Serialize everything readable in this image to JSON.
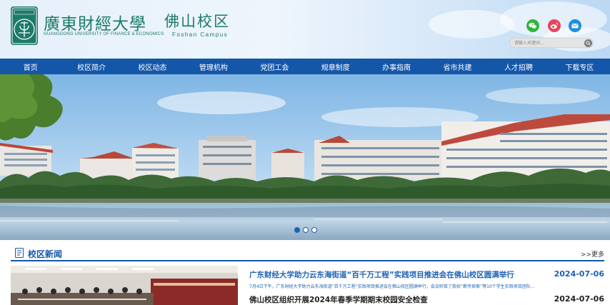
{
  "brand": {
    "title_cn": "廣東財經大學",
    "subtitle_en": "GUANGDONG UNIVERSITY OF FINANCE & ECONOMICS",
    "campus_cn": "佛山校区",
    "campus_en": "Foshan Campus",
    "seal_text": "广东财经大学"
  },
  "header": {
    "social": [
      {
        "name": "wechat",
        "color": "#2fb63c"
      },
      {
        "name": "weibo",
        "color": "#e9455b"
      },
      {
        "name": "email",
        "color": "#1f8fdd"
      }
    ],
    "search_placeholder": "请输入关键词..."
  },
  "nav": {
    "items": [
      "首页",
      "校区简介",
      "校区动态",
      "管理机构",
      "党团工会",
      "规章制度",
      "办事指南",
      "省市共建",
      "人才招聘",
      "下载专区"
    ]
  },
  "banner": {
    "slide_count": 3,
    "active_slide": 1
  },
  "news": {
    "section_title": "校区新闻",
    "more_label": ">>更多",
    "items": [
      {
        "title": "广东财经大学助力云东海街道“百千万工程”实践项目推进会在佛山校区圆满举行",
        "date": "2024-07-06",
        "summary": "7月4日下午，广东财经大学助力云东海街道“百千万工程”实践项目推进会在佛山校区圆满举行，会议听取了我校“薪传探索”等10个学生实践项目团队…",
        "color": "#1d62b4"
      },
      {
        "title": "佛山校区组织开展2024年春季学期期末校园安全检查",
        "date": "2024-07-06",
        "color": "#222222"
      }
    ]
  },
  "colors": {
    "brand_green": "#1d7a6a",
    "nav_blue": "#1457a9",
    "accent_blue": "#1d62b4"
  }
}
